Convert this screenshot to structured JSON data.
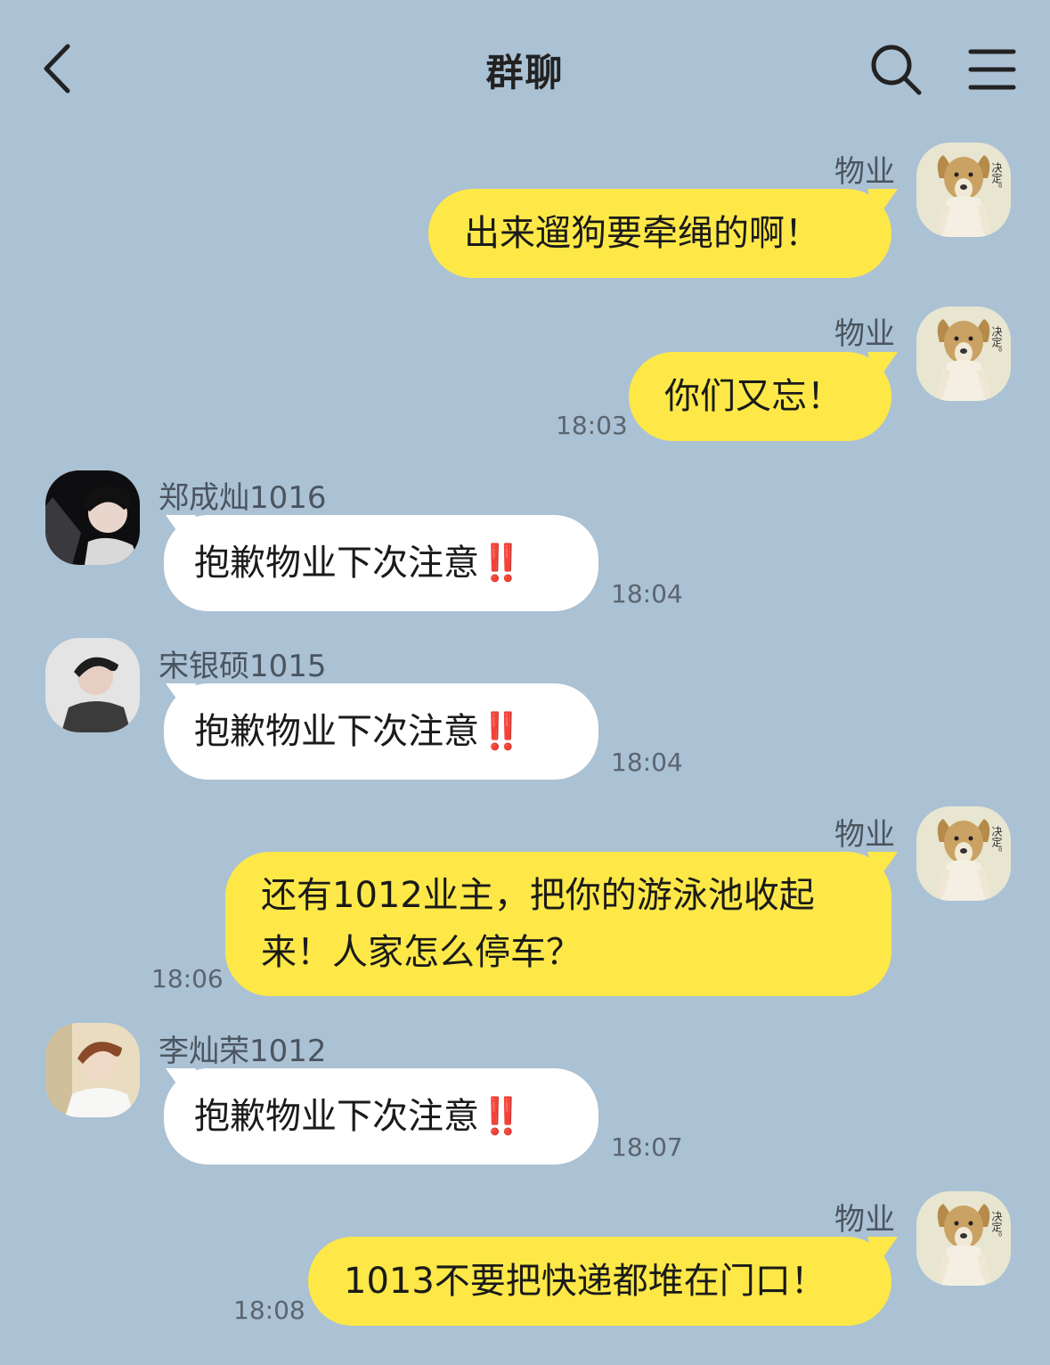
{
  "header": {
    "title": "群聊",
    "back_icon": "chevron-left-icon",
    "search_icon": "search-icon",
    "menu_icon": "hamburger-menu-icon"
  },
  "colors": {
    "background": "#abc1d4",
    "outgoing_bubble": "#fde848",
    "incoming_bubble": "#ffffff",
    "emphasis_mark": "#e02020"
  },
  "messages": [
    {
      "direction": "outgoing",
      "sender": "物业",
      "text": "出来遛狗要牵绳的啊！",
      "time": ""
    },
    {
      "direction": "outgoing",
      "sender": "物业",
      "text": "你们又忘！",
      "time": "18:03"
    },
    {
      "direction": "incoming",
      "sender": "郑成灿1016",
      "text": "抱歉物业下次注意",
      "emphasis": "‼️",
      "time": "18:04"
    },
    {
      "direction": "incoming",
      "sender": "宋银硕1015",
      "text": "抱歉物业下次注意",
      "emphasis": "‼️",
      "time": "18:04"
    },
    {
      "direction": "outgoing",
      "sender": "物业",
      "text": "还有1012业主，把你的游泳池收起来！人家怎么停车？",
      "time": "18:06"
    },
    {
      "direction": "incoming",
      "sender": "李灿荣1012",
      "text": "抱歉物业下次注意",
      "emphasis": "‼️",
      "time": "18:07"
    },
    {
      "direction": "outgoing",
      "sender": "物业",
      "text": "1013不要把快递都堆在门口！",
      "time": "18:08"
    }
  ],
  "avatar_caption": "决定。"
}
